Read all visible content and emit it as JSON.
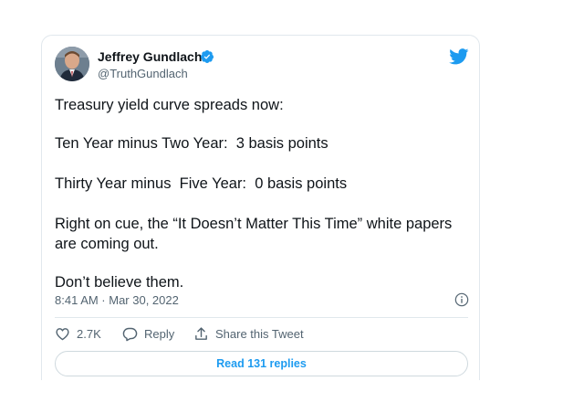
{
  "author": {
    "name": "Jeffrey Gundlach",
    "handle": "@TruthGundlach",
    "verified": true
  },
  "tweet": {
    "paragraphs": [
      "Treasury yield curve spreads now:",
      "Ten Year minus Two Year:  3 basis points",
      "Thirty Year minus  Five Year:  0 basis points",
      "Right on cue, the “It Doesn’t Matter This Time” white papers are coming out.",
      "Don’t believe them."
    ],
    "timestamp": "8:41 AM · Mar 30, 2022"
  },
  "actions": {
    "likes": "2.7K",
    "reply_label": "Reply",
    "share_label": "Share this Tweet",
    "read_replies_label": "Read 131 replies"
  },
  "colors": {
    "twitter_blue": "#1d9bf0",
    "text_primary": "#0f1419",
    "text_secondary": "#536471",
    "border": "#e1e8ed"
  },
  "icons": [
    "avatar",
    "verified-badge-icon",
    "twitter-bird-icon",
    "info-icon",
    "heart-icon",
    "reply-icon",
    "share-icon"
  ]
}
